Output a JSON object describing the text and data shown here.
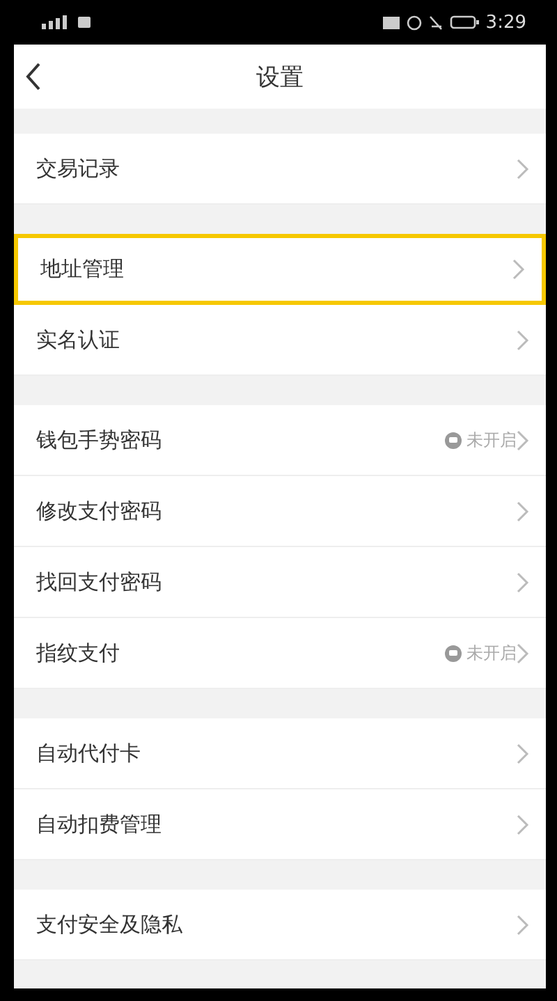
{
  "status_bar": {
    "time": "3:29"
  },
  "header": {
    "title": "设置"
  },
  "groups": [
    {
      "items": [
        {
          "label": "交易记录",
          "selected": false
        }
      ]
    },
    {
      "items": [
        {
          "label": "地址管理",
          "selected": true
        },
        {
          "label": "实名认证",
          "selected": false
        }
      ]
    },
    {
      "items": [
        {
          "label": "钱包手势密码",
          "status": "未开启",
          "selected": false
        },
        {
          "label": "修改支付密码",
          "selected": false
        },
        {
          "label": "找回支付密码",
          "selected": false
        },
        {
          "label": "指纹支付",
          "status": "未开启",
          "selected": false
        }
      ]
    },
    {
      "items": [
        {
          "label": "自动代付卡",
          "selected": false
        },
        {
          "label": "自动扣费管理",
          "selected": false
        }
      ]
    },
    {
      "items": [
        {
          "label": "支付安全及隐私",
          "selected": false
        }
      ]
    }
  ]
}
